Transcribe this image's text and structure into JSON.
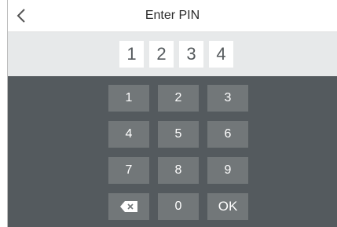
{
  "header": {
    "title": "Enter PIN",
    "back_icon": "chevron-left-icon"
  },
  "pin": {
    "digits": [
      "1",
      "2",
      "3",
      "4"
    ]
  },
  "keypad": {
    "keys": [
      "1",
      "2",
      "3",
      "4",
      "5",
      "6",
      "7",
      "8",
      "9",
      "",
      "0",
      "OK"
    ],
    "backspace_icon": "backspace-icon"
  },
  "colors": {
    "header_bg": "#ffffff",
    "pin_row_bg": "#e7e9ea",
    "keypad_bg": "#545a5e",
    "key_bg": "#727779",
    "key_text": "#ffffff",
    "pin_digit_text": "#555a5d"
  }
}
